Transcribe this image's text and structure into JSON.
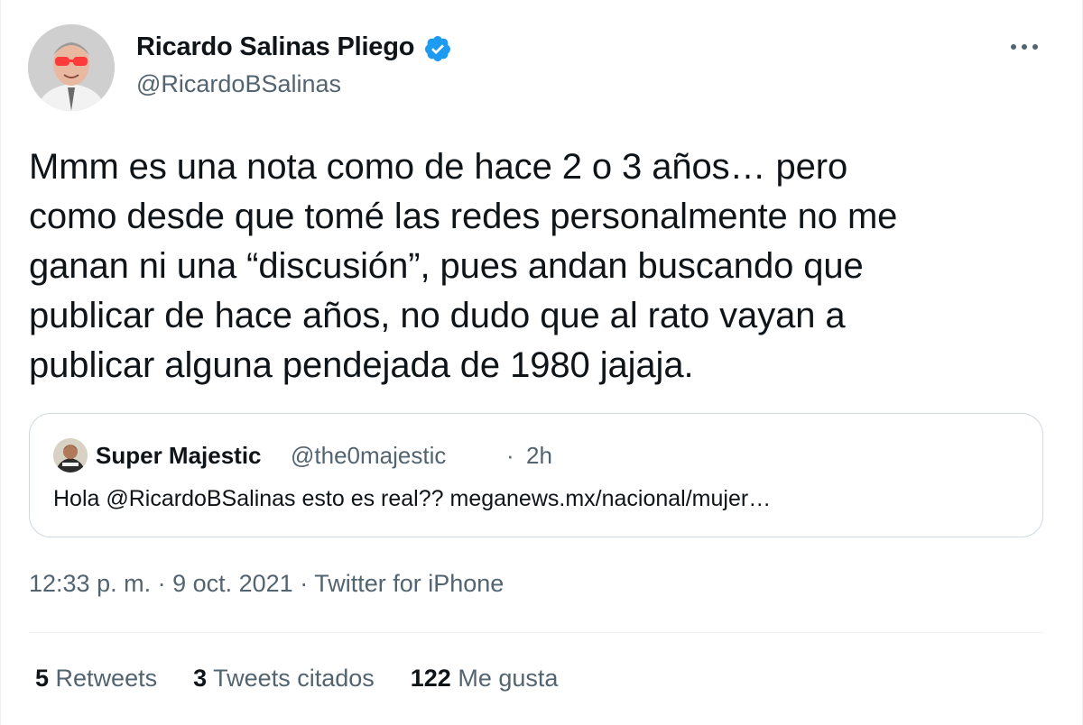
{
  "author": {
    "name": "Ricardo Salinas Pliego",
    "handle": "@RicardoBSalinas",
    "verified_icon": "verified-badge-icon",
    "avatar": "author-avatar"
  },
  "tweet": {
    "lines": [
      "Mmm es una nota como de hace 2 o 3 años… pero",
      "como desde que tomé las redes personalmente no me",
      "ganan ni una “discusión”, pues andan buscando que",
      "publicar de hace años, no dudo que al rato vayan a",
      "publicar alguna pendejada de 1980 jajaja."
    ]
  },
  "quoted_tweet": {
    "name": "Super Majestic",
    "handle": "@the0majestic",
    "separator": "·",
    "time": "2h",
    "text": "Hola @RicardoBSalinas esto es real?? meganews.mx/nacional/mujer…"
  },
  "meta": {
    "time": "12:33 p. m.",
    "sep1": " · ",
    "date": "9 oct. 2021",
    "sep2": " · ",
    "source": "Twitter for iPhone"
  },
  "stats": {
    "retweets_count": "5",
    "retweets_label": "Retweets",
    "quotes_count": "3",
    "quotes_label": "Tweets citados",
    "likes_count": "122",
    "likes_label": "Me gusta"
  },
  "icons": {
    "more": "more-options-icon"
  },
  "colors": {
    "text": "#0f1419",
    "secondary": "#536471",
    "verified": "#1d9bf0",
    "border": "#cfd9de"
  }
}
